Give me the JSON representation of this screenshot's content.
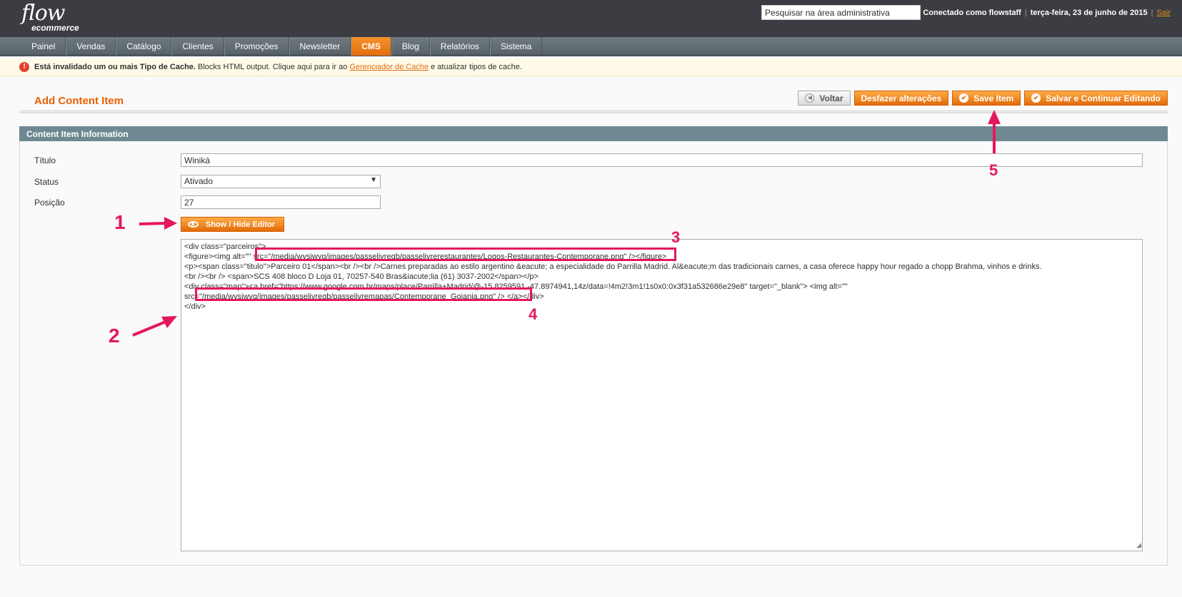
{
  "header": {
    "logo_main": "flow",
    "logo_sub": "ecommerce",
    "search_placeholder": "Pesquisar na área administrativa",
    "logged_as": "Conectado como flowstaff",
    "date": "terça-feira, 23 de junho de 2015",
    "logout": "Sair"
  },
  "nav": {
    "items": [
      "Painel",
      "Vendas",
      "Catálogo",
      "Clientes",
      "Promoções",
      "Newsletter",
      "CMS",
      "Blog",
      "Relatórios",
      "Sistema"
    ],
    "active": "CMS"
  },
  "notice": {
    "bold": "Está invalidado um ou mais Tipo de Cache.",
    "text": " Blocks HTML output. Clique aqui para ir ao ",
    "link": "Gerenciador de Cache",
    "text2": " e atualizar tipos de cache."
  },
  "page": {
    "title": "Add Content Item",
    "buttons": {
      "back": "Voltar",
      "reset": "Desfazer alterações",
      "save": "Save Item",
      "save_continue": "Salvar e Continuar Editando"
    }
  },
  "form": {
    "section_title": "Content Item Information",
    "titulo_label": "Título",
    "titulo_value": "Winiká",
    "status_label": "Status",
    "status_value": "Ativado",
    "posicao_label": "Posição",
    "posicao_value": "27",
    "editor_toggle": "Show / Hide Editor",
    "content_lines": [
      "<div class=\"parceiros\">",
      "<figure><img alt=\"\" src=\"/media/wysiwyg/images/passelivregb/passelivrerestaurantes/Logos-Restaurantes-Contemporane.png\" /></figure>",
      "<p><span class=\"titulo\">Parceiro 01</span><br /><br />Carnes preparadas ao estilo argentino &eacute; a especialidade do Parrilla Madrid. Al&eacute;m das tradicionais carnes, a casa oferece happy hour regado a chopp Brahma, vinhos e drinks.",
      "<br /><br /> <span>SCS 408 bloco D Loja 01, 70257-540 Bras&iacute;lia (61) 3037-2002</span></p>",
      "<div class=\"map\"><a href=\"https://www.google.com.br/maps/place/Parrilla+Madrid/@-15.8259591,-47.8974941,14z/data=!4m2!3m1!1s0x0:0x3f31a532686e29e8\" target=\"_blank\"> <img alt=\"\"",
      "src=\"/media/wysiwyg/images/passelivregb/passelivremapas/Contemporane_Goiania.png\" /> </a></div>",
      "</div>"
    ]
  },
  "annotations": {
    "labels": [
      "1",
      "2",
      "3",
      "4",
      "5"
    ],
    "color": "#e5175c"
  }
}
